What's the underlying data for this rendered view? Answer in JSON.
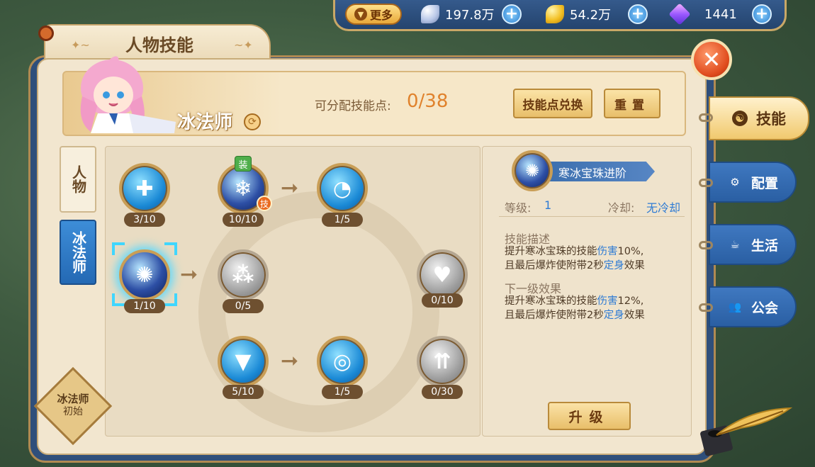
{
  "currency": {
    "more_label": "更多",
    "silver": "197.8万",
    "gold": "54.2万",
    "diamond": "1441"
  },
  "window": {
    "title": "人物技能"
  },
  "header": {
    "class_name": "冰法师",
    "points_label": "可分配技能点:",
    "points_value": "0/38",
    "exchange_button": "技能点兑换",
    "reset_button": "重置"
  },
  "left_tabs": [
    {
      "label": "人物",
      "active": false
    },
    {
      "label": "冰法师",
      "active": true
    }
  ],
  "skill_tree": {
    "equip_badge": "装",
    "skill_badge": "技",
    "nodes": [
      {
        "level": "3/10",
        "icon": "diamond-plus-icon"
      },
      {
        "level": "10/10",
        "icon": "ice-crystal-icon"
      },
      {
        "level": "1/5",
        "icon": "swirl-plus-icon"
      },
      {
        "level": "1/10",
        "icon": "ice-orb-icon"
      },
      {
        "level": "0/5",
        "icon": "triple-orb-icon"
      },
      {
        "level": "0/10",
        "icon": "heart-plus-icon"
      },
      {
        "level": "5/10",
        "icon": "diamond-down-icon"
      },
      {
        "level": "1/5",
        "icon": "vortex-icon"
      },
      {
        "level": "0/30",
        "icon": "triple-arrow-up-icon"
      }
    ]
  },
  "detail": {
    "skill_name": "寒冰宝珠进阶",
    "level_label": "等级:",
    "level_value": "1",
    "cooldown_label": "冷却:",
    "cooldown_value": "无冷却",
    "desc_title": "技能描述",
    "desc_l1_a": "提升寒冰宝珠的技能",
    "desc_l1_hl": "伤害",
    "desc_l1_b": "10%,",
    "desc_l2_a": "且最后爆炸使附带2秒",
    "desc_l2_hl": "定身",
    "desc_l2_b": "效果",
    "next_title": "下一级效果",
    "next_l1_a": "提升寒冰宝珠的技能",
    "next_l1_hl": "伤害",
    "next_l1_b": "12%,",
    "next_l2_a": "且最后爆炸使附带2秒",
    "next_l2_hl": "定身",
    "next_l2_b": "效果",
    "upgrade_button": "升级"
  },
  "class_badge": {
    "line1": "冰法师",
    "line2": "初始"
  },
  "right_tabs": [
    {
      "label": "技能",
      "icon": "skill-icon",
      "active": true
    },
    {
      "label": "配置",
      "icon": "gear-icon",
      "active": false
    },
    {
      "label": "生活",
      "icon": "cup-icon",
      "active": false
    },
    {
      "label": "公会",
      "icon": "people-icon",
      "active": false
    }
  ],
  "colors": {
    "accent_orange": "#e0822c",
    "highlight_blue": "#2e7bd4",
    "tab_blue": "#2a5fa3"
  }
}
